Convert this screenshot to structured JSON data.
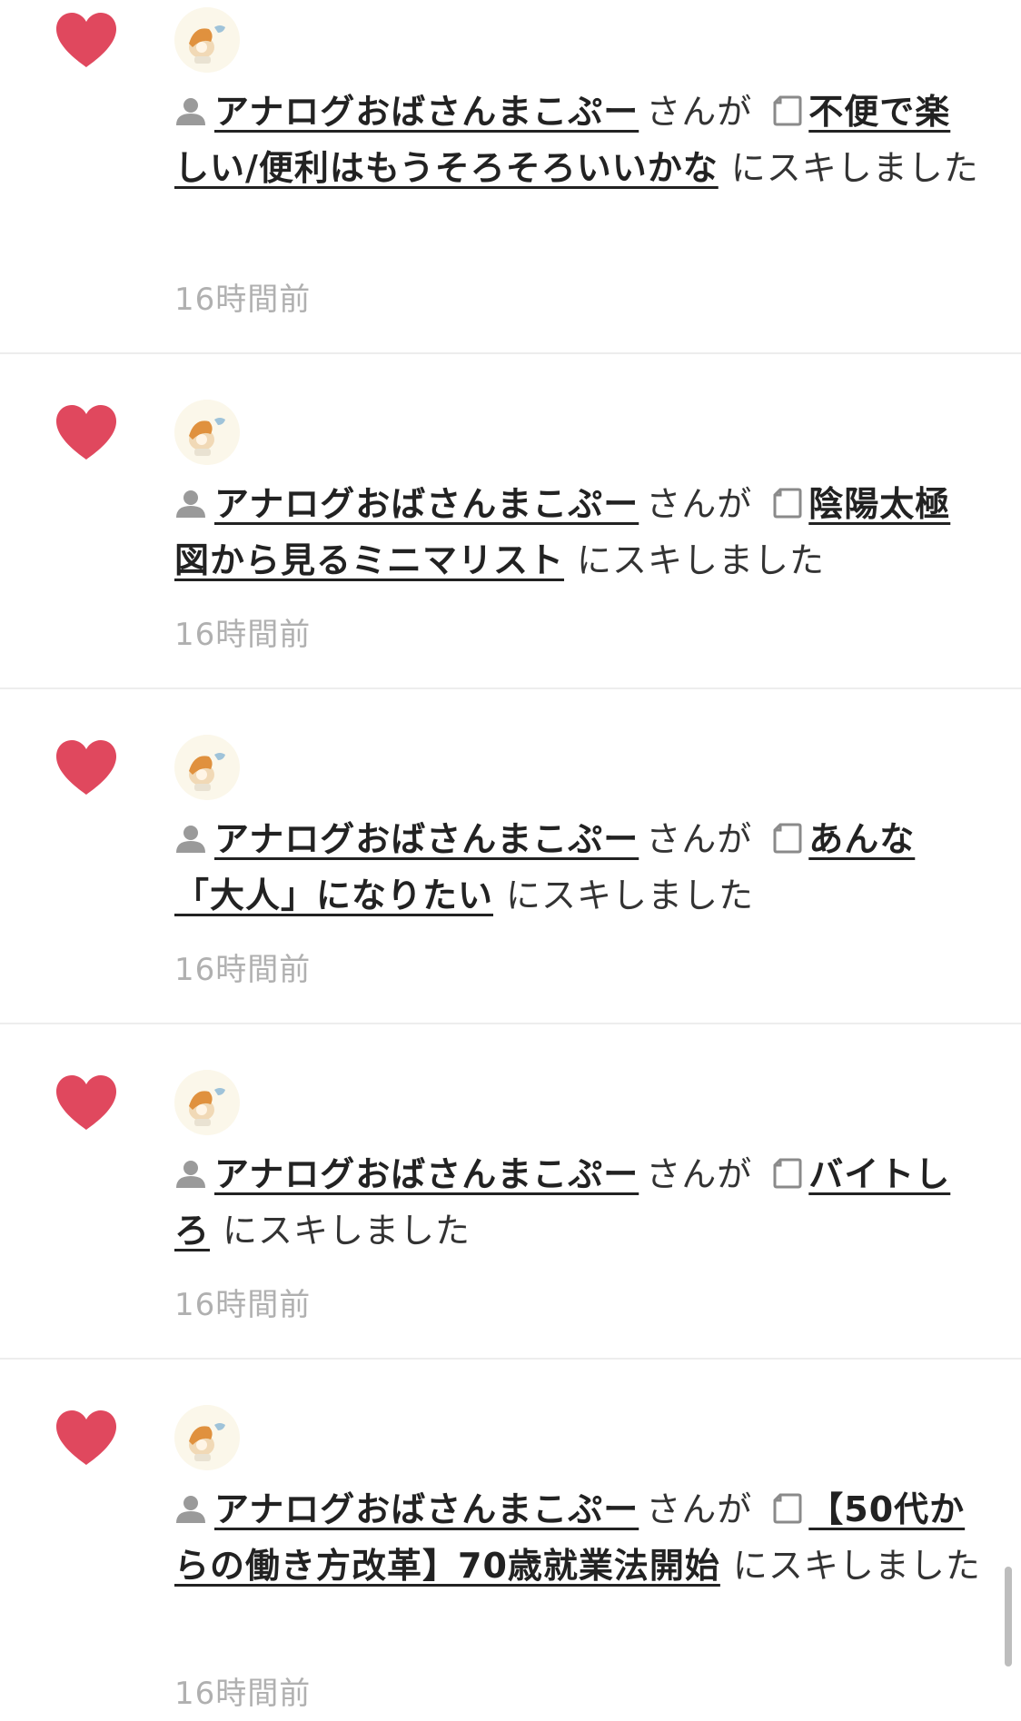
{
  "items": [
    {
      "user_name": "アナログおばさんまこぷー",
      "connector": "さんが",
      "post_title": "不便で楽しい/便利はもうそろそろいいかな",
      "action": "にスキしました",
      "time": "16時間前"
    },
    {
      "user_name": "アナログおばさんまこぷー",
      "connector": "さんが",
      "post_title": "陰陽太極図から見るミニマリスト",
      "action": "にスキしました",
      "time": "16時間前"
    },
    {
      "user_name": "アナログおばさんまこぷー",
      "connector": "さんが",
      "post_title": "あんな「大人」になりたい",
      "action": "にスキしました",
      "time": "16時間前"
    },
    {
      "user_name": "アナログおばさんまこぷー",
      "connector": "さんが",
      "post_title": "バイトしろ",
      "action": "にスキしました",
      "time": "16時間前"
    },
    {
      "user_name": "アナログおばさんまこぷー",
      "connector": "さんが",
      "post_title": "【50代からの働き方改革】70歳就業法開始",
      "action": "にスキしました",
      "time": "16時間前"
    }
  ],
  "colors": {
    "heart": "#e0485e",
    "link": "#222222",
    "timestamp": "#b0b0b0",
    "divider": "#ededed"
  },
  "icons": {
    "like": "heart-icon",
    "user": "person-icon",
    "post": "document-icon"
  }
}
